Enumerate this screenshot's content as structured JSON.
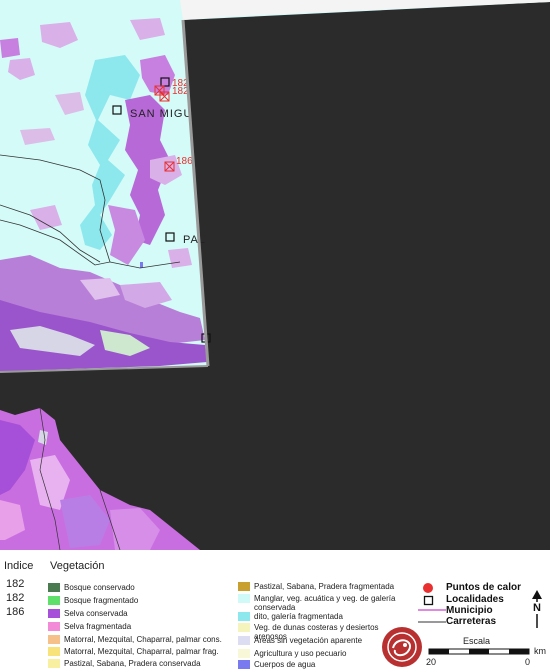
{
  "map": {
    "localities": [
      "SAN MIGU",
      "PAL"
    ],
    "fire_labels": [
      "182",
      "182",
      "186"
    ]
  },
  "legend": {
    "header_index": "Indice",
    "header_vegetation": "Vegetación",
    "indices": [
      "182",
      "182",
      "186"
    ],
    "vegetation_left": [
      {
        "label": "Bosque conservado",
        "color": "#4a7a50"
      },
      {
        "label": "Bosque fragmentado",
        "color": "#5ee06a"
      },
      {
        "label": "Selva conservada",
        "color": "#a64fd8"
      },
      {
        "label": "Selva fragmentada",
        "color": "#f28ad8"
      },
      {
        "label": "Matorral, Mezquital, Chaparral, palmar cons.",
        "color": "#f6c08a"
      },
      {
        "label": "Matorral, Mezquital, Chaparral, palmar frag.",
        "color": "#f8e27a"
      },
      {
        "label": "Pastizal, Sabana, Pradera conservada",
        "color": "#f8f0a0"
      }
    ],
    "vegetation_right": [
      {
        "label": "Pastizal, Sabana, Pradera fragmentada",
        "color": "#c8a030"
      },
      {
        "label": "Manglar, veg. acuática y veg. de galería conservada",
        "color": "#cffaf8"
      },
      {
        "label": "dito, galería fragmentada",
        "color": "#8de8ee"
      },
      {
        "label": "Veg. de dunas costeras y desiertos arenosos",
        "color": "#f4f4bc"
      },
      {
        "label": "Areas sin vegetación aparente",
        "color": "#dcdcf2"
      },
      {
        "label": "Agricultura y uso pecuario",
        "color": "#f8f8d8"
      },
      {
        "label": "Cuerpos de agua",
        "color": "#7a7af0"
      }
    ],
    "symbols": {
      "fire": "Puntos de calor",
      "locality": "Localidades",
      "municipality": "Municipio",
      "roads": "Carreteras"
    },
    "scale": {
      "title": "Escala",
      "left": "20",
      "right": "0",
      "unit": "km"
    },
    "north_letter": "N",
    "colors": {
      "fire": "#e83030",
      "municipality": "#cc44cc",
      "roads": "#333333"
    }
  }
}
